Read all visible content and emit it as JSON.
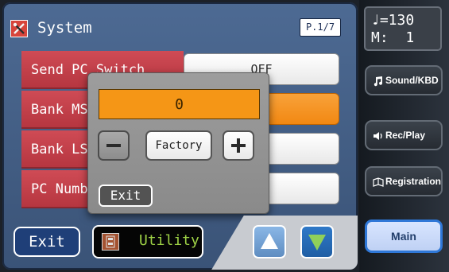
{
  "system_screen": {
    "title": "System",
    "page_indicator": "P.1/7"
  },
  "params": [
    {
      "label": "Send PC Switch",
      "value": "OFF"
    },
    {
      "label": "Bank MS",
      "value": ""
    },
    {
      "label": "Bank LS",
      "value": ""
    },
    {
      "label": "PC Numb",
      "value": ""
    }
  ],
  "popup": {
    "value": "0",
    "minus_label": "−",
    "factory_label": "Factory",
    "plus_label": "+",
    "exit_label": "Exit"
  },
  "bottom": {
    "exit_label": "Exit",
    "utility_label": "Utility"
  },
  "right_panel": {
    "tempo_line": "♩=130",
    "measure_line": "M:  1",
    "sound_label": "Sound/KBD",
    "rec_label": "Rec/Play",
    "registration_label": "Registration",
    "main_label": "Main"
  },
  "icons": {
    "title_icon": "tools-icon",
    "utility_icon": "panel-icon",
    "up_icon": "arrow-up-icon",
    "down_icon": "arrow-down-icon",
    "sound_icon": "music-note-icon",
    "rec_icon": "speaker-icon",
    "registration_icon": "registration-book-icon"
  },
  "colors": {
    "accent_orange": "#f59616",
    "param_red": "#c9444f",
    "utility_green": "#9ed246",
    "main_blue": "#2f78d8"
  }
}
